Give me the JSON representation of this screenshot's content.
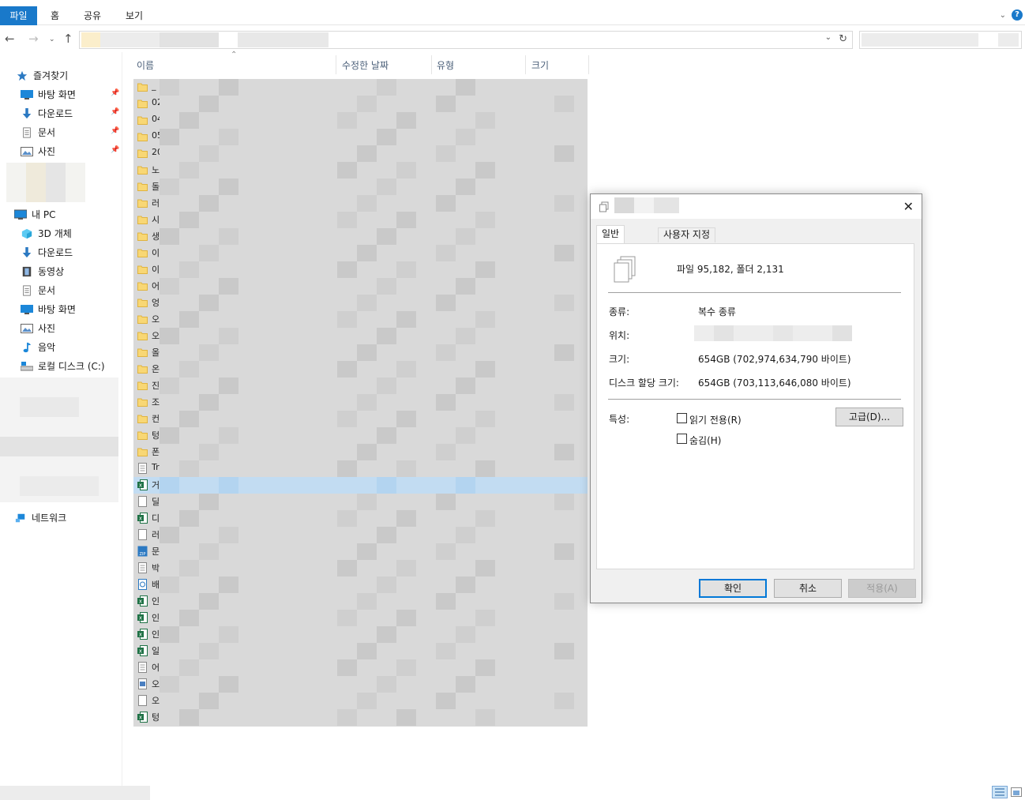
{
  "ribbon": {
    "tabs": [
      "파일",
      "홈",
      "공유",
      "보기"
    ],
    "help": "?"
  },
  "nav": {
    "quick_access": "즐겨찾기",
    "quick_items": [
      "바탕 화면",
      "다운로드",
      "문서",
      "사진"
    ],
    "this_pc": "내 PC",
    "pc_items": [
      "3D 개체",
      "다운로드",
      "동영상",
      "문서",
      "바탕 화면",
      "사진",
      "음악",
      "로컬 디스크 (C:)"
    ],
    "network": "네트워크"
  },
  "columns": {
    "name": "이름",
    "date": "수정한 날짜",
    "type": "유형",
    "size": "크기"
  },
  "rows": [
    {
      "icon": "folder",
      "name": "_"
    },
    {
      "icon": "folder",
      "name": "02"
    },
    {
      "icon": "folder",
      "name": "04"
    },
    {
      "icon": "folder",
      "name": "05"
    },
    {
      "icon": "folder",
      "name": "20"
    },
    {
      "icon": "folder",
      "name": "노"
    },
    {
      "icon": "folder",
      "name": "돌"
    },
    {
      "icon": "folder",
      "name": "러"
    },
    {
      "icon": "folder",
      "name": "시"
    },
    {
      "icon": "folder",
      "name": "생"
    },
    {
      "icon": "folder",
      "name": "이"
    },
    {
      "icon": "folder",
      "name": "이"
    },
    {
      "icon": "folder",
      "name": "어"
    },
    {
      "icon": "folder",
      "name": "엉"
    },
    {
      "icon": "folder",
      "name": "오"
    },
    {
      "icon": "folder",
      "name": "오"
    },
    {
      "icon": "folder",
      "name": "올"
    },
    {
      "icon": "folder",
      "name": "온"
    },
    {
      "icon": "folder",
      "name": "진"
    },
    {
      "icon": "folder",
      "name": "조"
    },
    {
      "icon": "folder",
      "name": "컨"
    },
    {
      "icon": "folder",
      "name": "텅"
    },
    {
      "icon": "folder",
      "name": "폰"
    },
    {
      "icon": "text",
      "name": "Tr"
    },
    {
      "icon": "excel",
      "name": "거",
      "selected": true
    },
    {
      "icon": "blank",
      "name": "딜"
    },
    {
      "icon": "excel",
      "name": "디"
    },
    {
      "icon": "blank",
      "name": "러"
    },
    {
      "icon": "zip",
      "name": "문"
    },
    {
      "icon": "text",
      "name": "박"
    },
    {
      "icon": "hwp",
      "name": "배"
    },
    {
      "icon": "excel",
      "name": "인"
    },
    {
      "icon": "excel",
      "name": "인"
    },
    {
      "icon": "excel",
      "name": "인"
    },
    {
      "icon": "excel",
      "name": "일"
    },
    {
      "icon": "text",
      "name": "어"
    },
    {
      "icon": "image",
      "name": "오"
    },
    {
      "icon": "blank",
      "name": "오"
    },
    {
      "icon": "excel",
      "name": "텅"
    }
  ],
  "dialog": {
    "tabs": [
      "일반",
      "사용자 지정"
    ],
    "summary": "파일 95,182, 폴더 2,131",
    "type_label": "종류:",
    "type_value": "복수 종류",
    "location_label": "위치:",
    "size_label": "크기:",
    "size_value": "654GB (702,974,634,790 바이트)",
    "disk_label": "디스크 할당 크기:",
    "disk_value": "654GB (703,113,646,080 바이트)",
    "attr_label": "특성:",
    "readonly": "읽기 전용(R)",
    "hidden": "숨김(H)",
    "advanced": "고급(D)...",
    "ok": "확인",
    "cancel": "취소",
    "apply": "적용(A)"
  },
  "colors": {
    "accent": "#1979ca",
    "selection": "#cce8ff",
    "folder": "#f8d775"
  }
}
